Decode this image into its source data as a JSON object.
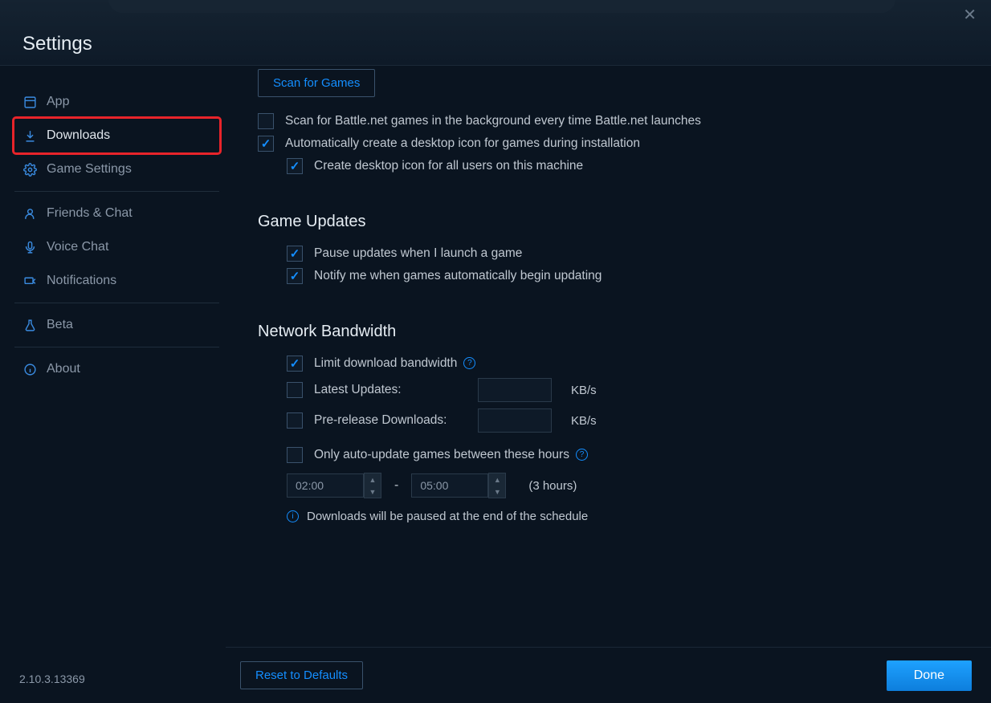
{
  "header": {
    "title": "Settings"
  },
  "sidebar": {
    "items": [
      {
        "label": "App"
      },
      {
        "label": "Downloads"
      },
      {
        "label": "Game Settings"
      },
      {
        "label": "Friends & Chat"
      },
      {
        "label": "Voice Chat"
      },
      {
        "label": "Notifications"
      },
      {
        "label": "Beta"
      },
      {
        "label": "About"
      }
    ],
    "version": "2.10.3.13369"
  },
  "scan": {
    "button": "Scan for Games",
    "background_scan": "Scan for Battle.net games in the background every time Battle.net launches",
    "auto_desktop_icon": "Automatically create a desktop icon for games during installation",
    "desktop_icon_all_users": "Create desktop icon for all users on this machine"
  },
  "updates": {
    "heading": "Game Updates",
    "pause_on_launch": "Pause updates when I launch a game",
    "notify_auto": "Notify me when games automatically begin updating"
  },
  "bandwidth": {
    "heading": "Network Bandwidth",
    "limit_label": "Limit download bandwidth",
    "latest_label": "Latest Updates:",
    "prerelease_label": "Pre-release Downloads:",
    "unit": "KB/s",
    "latest_value": "",
    "prerelease_value": "",
    "only_between_label": "Only auto-update games between these hours",
    "time_start": "02:00",
    "time_end": "05:00",
    "dash": "-",
    "duration": "(3 hours)",
    "info_msg": "Downloads will be paused at the end of the schedule"
  },
  "footer": {
    "reset": "Reset to Defaults",
    "done": "Done"
  }
}
